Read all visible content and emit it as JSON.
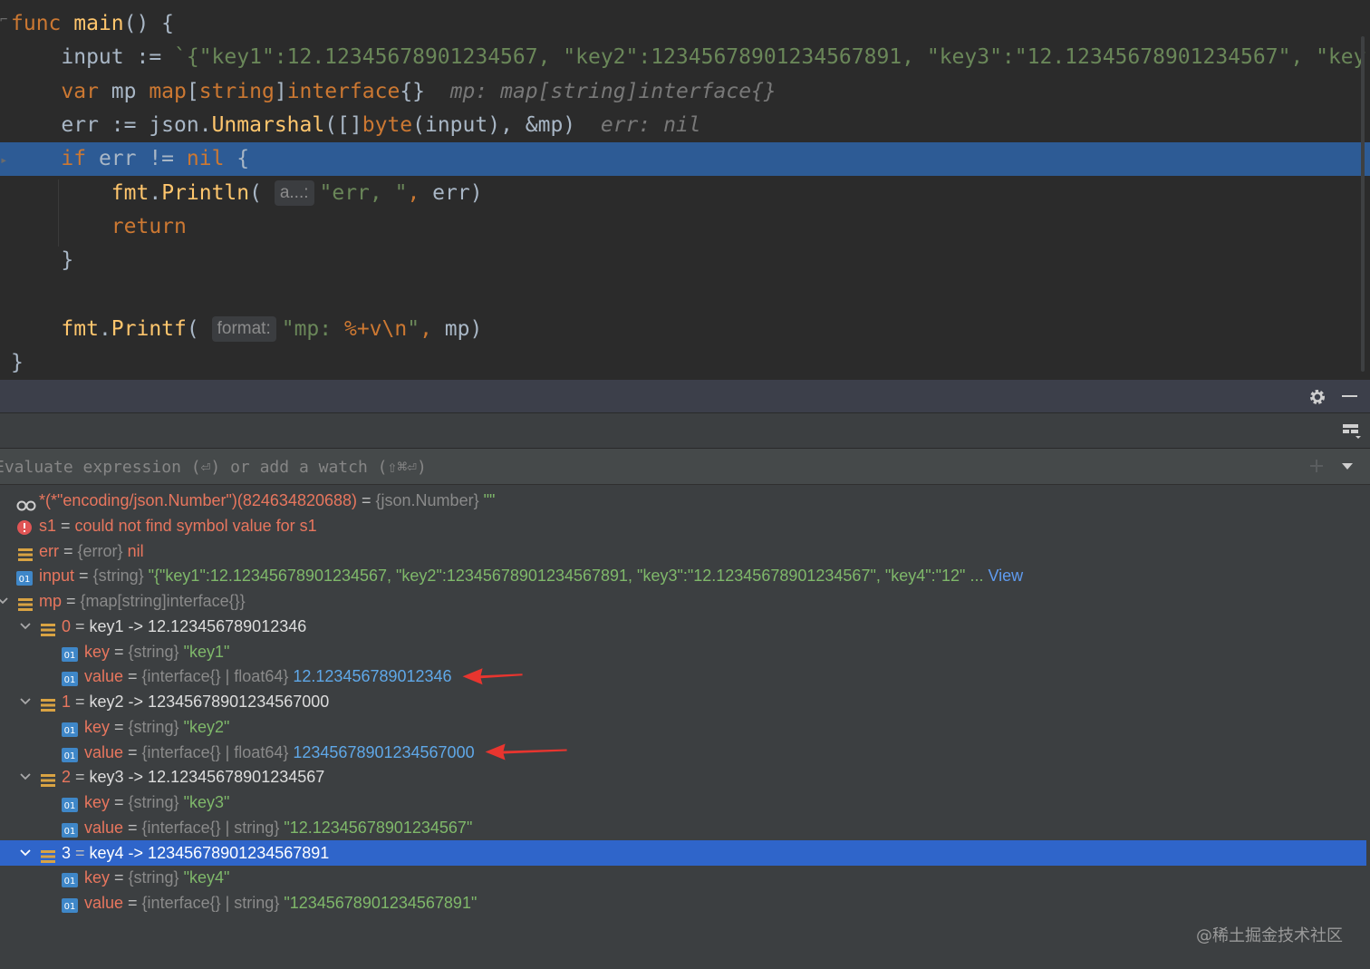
{
  "editor": {
    "lines": [
      {
        "parts": [
          [
            "kw",
            "func "
          ],
          [
            "fn",
            "main"
          ],
          [
            "p",
            "() {"
          ]
        ]
      },
      {
        "parts": [
          [
            "p",
            "    input := "
          ],
          [
            "str",
            "`{\"key1\":12.12345678901234567, \"key2\":12345678901234567891, \"key3\":\"12.12345678901234567\", \"key"
          ]
        ]
      },
      {
        "parts": [
          [
            "p",
            "    "
          ],
          [
            "kw",
            "var "
          ],
          [
            "p",
            "mp "
          ],
          [
            "ty",
            "map"
          ],
          [
            "p",
            "["
          ],
          [
            "ty",
            "string"
          ],
          [
            "p",
            "]"
          ],
          [
            "ty",
            "interface"
          ],
          [
            "p",
            "{}  "
          ],
          [
            "cm",
            "mp: map[string]interface{}"
          ]
        ]
      },
      {
        "parts": [
          [
            "p",
            "    err := "
          ],
          [
            "pkg",
            "json"
          ],
          [
            "p",
            "."
          ],
          [
            "fn",
            "Unmarshal"
          ],
          [
            "p",
            "([]"
          ],
          [
            "ty",
            "byte"
          ],
          [
            "p",
            "(input), &mp)  "
          ],
          [
            "cm",
            "err: nil"
          ]
        ]
      },
      {
        "parts": [
          [
            "p",
            "    "
          ],
          [
            "kw",
            "if "
          ],
          [
            "p",
            "err != "
          ],
          [
            "kw",
            "nil "
          ],
          [
            "p",
            "{"
          ]
        ]
      },
      {
        "parts": [
          [
            "p",
            "        "
          ],
          [
            "fn",
            "fmt"
          ],
          [
            "p",
            "."
          ],
          [
            "fn",
            "Println"
          ],
          [
            "p",
            "( "
          ],
          [
            "hint",
            "a...:"
          ],
          [
            "str",
            "\"err, \""
          ],
          [
            "kw",
            ", "
          ],
          [
            "p",
            "err)"
          ]
        ]
      },
      {
        "parts": [
          [
            "p",
            "        "
          ],
          [
            "kw",
            "return"
          ]
        ]
      },
      {
        "parts": [
          [
            "p",
            "    }"
          ]
        ]
      },
      {
        "parts": [
          [
            "p",
            ""
          ]
        ]
      },
      {
        "parts": [
          [
            "p",
            "    "
          ],
          [
            "fn",
            "fmt"
          ],
          [
            "p",
            "."
          ],
          [
            "fn",
            "Printf"
          ],
          [
            "p",
            "( "
          ],
          [
            "hint",
            "format:"
          ],
          [
            "str",
            "\"mp: "
          ],
          [
            "esc",
            "%+v\\n"
          ],
          [
            "str",
            "\""
          ],
          [
            "kw",
            ", "
          ],
          [
            "p",
            "mp)"
          ]
        ]
      },
      {
        "parts": [
          [
            "p",
            "}"
          ]
        ]
      }
    ]
  },
  "panel": {
    "eval_placeholder": "Evaluate expression (⏎) or add a watch (⇧⌘⏎)"
  },
  "variables": [
    {
      "icon": "watch-icon",
      "indent": 0,
      "chev": "",
      "name": "*(*\"encoding/json.Number\")(824634820688)",
      "type": "{json.Number}",
      "value": "\"\"",
      "vclass": "vval-str"
    },
    {
      "icon": "error-icon",
      "indent": 0,
      "chev": "",
      "name": "s1",
      "type": "",
      "value": "could not find symbol value for s1",
      "vclass": "vval-red"
    },
    {
      "icon": "list-icon",
      "indent": 0,
      "chev": "",
      "name": "err",
      "type": "{error}",
      "value": "nil",
      "vclass": "vval-red"
    },
    {
      "icon": "binary-icon",
      "indent": 0,
      "chev": "",
      "name": "input",
      "type": "{string}",
      "value": "\"{\"key1\":12.12345678901234567, \"key2\":12345678901234567891, \"key3\":\"12.12345678901234567\", \"key4\":\"12\" ...",
      "vclass": "vval-str",
      "link": "View"
    },
    {
      "icon": "list-icon",
      "indent": 0,
      "chev": "v",
      "name": "mp",
      "type": "{map[string]interface{}}",
      "value": "",
      "vclass": "vval-str"
    },
    {
      "icon": "list-icon",
      "indent": 1,
      "chev": "v",
      "name": "0",
      "summary": "key1 -> 12.123456789012346"
    },
    {
      "icon": "binary-icon",
      "indent": 2,
      "chev": "",
      "name": "key",
      "type": "{string}",
      "value": "\"key1\"",
      "vclass": "vval-str"
    },
    {
      "icon": "binary-icon",
      "indent": 2,
      "chev": "",
      "name": "value",
      "type": "{interface{} | float64}",
      "value": "12.123456789012346",
      "vclass": "vval-num",
      "arrow": true
    },
    {
      "icon": "list-icon",
      "indent": 1,
      "chev": "v",
      "name": "1",
      "summary": "key2 -> 12345678901234567000"
    },
    {
      "icon": "binary-icon",
      "indent": 2,
      "chev": "",
      "name": "key",
      "type": "{string}",
      "value": "\"key2\"",
      "vclass": "vval-str"
    },
    {
      "icon": "binary-icon",
      "indent": 2,
      "chev": "",
      "name": "value",
      "type": "{interface{} | float64}",
      "value": "12345678901234567000",
      "vclass": "vval-num",
      "arrow": true
    },
    {
      "icon": "list-icon",
      "indent": 1,
      "chev": "v",
      "name": "2",
      "summary": "key3 -> 12.12345678901234567"
    },
    {
      "icon": "binary-icon",
      "indent": 2,
      "chev": "",
      "name": "key",
      "type": "{string}",
      "value": "\"key3\"",
      "vclass": "vval-str"
    },
    {
      "icon": "binary-icon",
      "indent": 2,
      "chev": "",
      "name": "value",
      "type": "{interface{} | string}",
      "value": "\"12.12345678901234567\"",
      "vclass": "vval-str"
    },
    {
      "icon": "list-icon",
      "indent": 1,
      "chev": "v",
      "name": "3",
      "summary": "key4 -> 12345678901234567891",
      "selected": true
    },
    {
      "icon": "binary-icon",
      "indent": 2,
      "chev": "",
      "name": "key",
      "type": "{string}",
      "value": "\"key4\"",
      "vclass": "vval-str"
    },
    {
      "icon": "binary-icon",
      "indent": 2,
      "chev": "",
      "name": "value",
      "type": "{interface{} | string}",
      "value": "\"12345678901234567891\"",
      "vclass": "vval-str"
    }
  ],
  "watermark": "@稀土掘金技术社区",
  "colors": {
    "selection": "#2f65ca",
    "current_line": "#2d5b95",
    "arrow": "#e8352f"
  }
}
